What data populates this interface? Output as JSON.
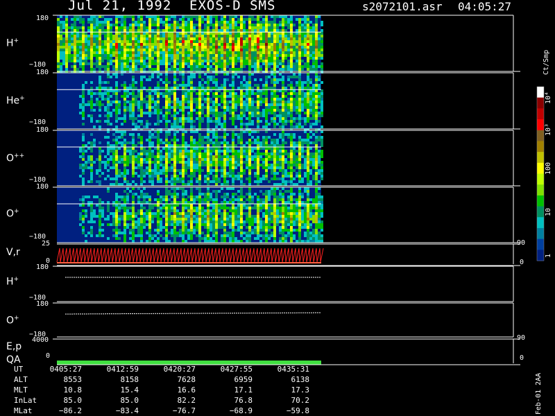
{
  "header": {
    "date": "Jul 21, 1992",
    "instrument": "EXOS-D SMS",
    "file": "s2072101.asr",
    "time": "04:05:27"
  },
  "panels": [
    {
      "label": "H",
      "sup": "+",
      "tick_top": "180",
      "tick_bottom": "−180"
    },
    {
      "label": "He",
      "sup": "+",
      "tick_top": "180",
      "tick_bottom": "−180"
    },
    {
      "label": "O",
      "sup": "++",
      "tick_top": "180",
      "tick_bottom": "−180"
    },
    {
      "label": "O",
      "sup": "+",
      "tick_top": "180",
      "tick_bottom": "−180"
    }
  ],
  "line_panels": [
    {
      "label": "V,r",
      "left_ticks": [
        "25",
        "0"
      ],
      "right_ticks": [
        "90",
        "0"
      ]
    },
    {
      "label": "H",
      "sup": "+",
      "left_ticks": [
        "180",
        "−180"
      ],
      "right_ticks": []
    },
    {
      "label": "O",
      "sup": "+",
      "left_ticks": [
        "180",
        "−180"
      ],
      "right_ticks": []
    },
    {
      "label": "E,p",
      "label2": "QA",
      "left_ticks": [
        "4000",
        "0"
      ],
      "right_ticks": [
        "90",
        "0"
      ]
    }
  ],
  "colorbar": {
    "units": "Ct/Smp",
    "labels": [
      "10⁴",
      "10³",
      "100",
      "10",
      "1"
    ],
    "colors": [
      "#ffffff",
      "#8b0000",
      "#c00000",
      "#ff0000",
      "#806020",
      "#a08000",
      "#c0c000",
      "#ffff00",
      "#c0ff00",
      "#80e000",
      "#00c000",
      "#009060",
      "#00c0c0",
      "#0080a0",
      "#0040a0",
      "#002080"
    ]
  },
  "footer_note": "Feb-01 2AA",
  "table": {
    "row_labels": [
      "UT",
      "ALT",
      "MLT",
      "InLat",
      "MLat"
    ],
    "columns": [
      [
        "0405:27",
        "8553",
        "10.8",
        "85.0",
        "−86.2"
      ],
      [
        "0412:59",
        "8158",
        "15.4",
        "85.0",
        "−83.4"
      ],
      [
        "0420:27",
        "7628",
        "16.6",
        "82.2",
        "−76.7"
      ],
      [
        "0427:55",
        "6959",
        "17.1",
        "76.8",
        "−68.9"
      ],
      [
        "0435:31",
        "6138",
        "17.3",
        "70.2",
        "−59.8"
      ]
    ]
  },
  "chart_data": {
    "type": "heatmap",
    "title": "Jul 21, 1992   EXOS-D SMS",
    "x_ticks": [
      "0405:27",
      "0412:59",
      "0420:27",
      "0427:55",
      "0435:31"
    ],
    "series": [
      {
        "name": "H+",
        "ylim": [
          -180,
          180
        ],
        "relative_intensity": [
          0.6,
          0.7,
          0.75,
          0.8,
          0.65
        ]
      },
      {
        "name": "He+",
        "ylim": [
          -180,
          180
        ],
        "relative_intensity": [
          0.3,
          0.4,
          0.5,
          0.45,
          0.5
        ]
      },
      {
        "name": "O++",
        "ylim": [
          -180,
          180
        ],
        "relative_intensity": [
          0.3,
          0.45,
          0.55,
          0.5,
          0.5
        ]
      },
      {
        "name": "O+",
        "ylim": [
          -180,
          180
        ],
        "relative_intensity": [
          0.3,
          0.45,
          0.55,
          0.5,
          0.55
        ]
      }
    ],
    "colorbar_units": "Ct/Smp",
    "colorbar_scale": "log",
    "colorbar_range": [
      1,
      10000
    ]
  }
}
